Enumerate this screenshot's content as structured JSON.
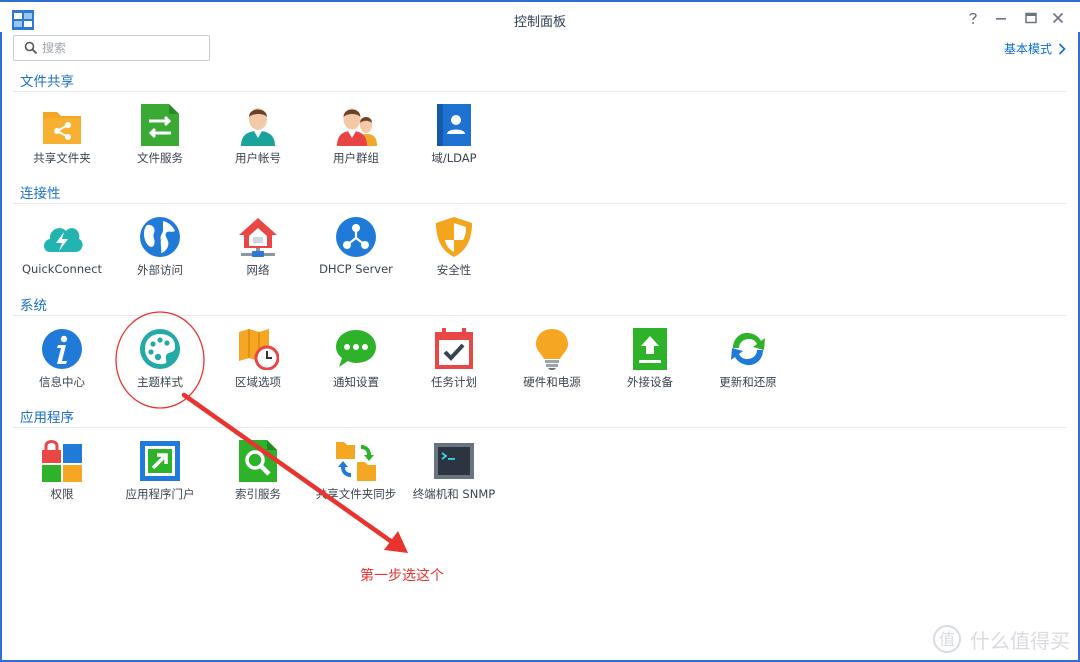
{
  "window": {
    "title": "控制面板"
  },
  "search": {
    "placeholder": "搜索"
  },
  "mode_link": "基本模式",
  "sections": {
    "file_sharing": {
      "title": "文件共享",
      "items": [
        "共享文件夹",
        "文件服务",
        "用户帐号",
        "用户群组",
        "域/LDAP"
      ]
    },
    "connectivity": {
      "title": "连接性",
      "items": [
        "QuickConnect",
        "外部访问",
        "网络",
        "DHCP Server",
        "安全性"
      ]
    },
    "system": {
      "title": "系统",
      "items": [
        "信息中心",
        "主题样式",
        "区域选项",
        "通知设置",
        "任务计划",
        "硬件和电源",
        "外接设备",
        "更新和还原"
      ]
    },
    "applications": {
      "title": "应用程序",
      "items": [
        "权限",
        "应用程序门户",
        "索引服务",
        "共享文件夹同步",
        "终端机和 SNMP"
      ]
    }
  },
  "annotation": {
    "text": "第一步选这个",
    "color": "#e8332e"
  },
  "watermark": {
    "text": "什么值得买",
    "logo": "值"
  },
  "colors": {
    "accent": "#1b6fc8",
    "frame": "#2f6fd2"
  }
}
